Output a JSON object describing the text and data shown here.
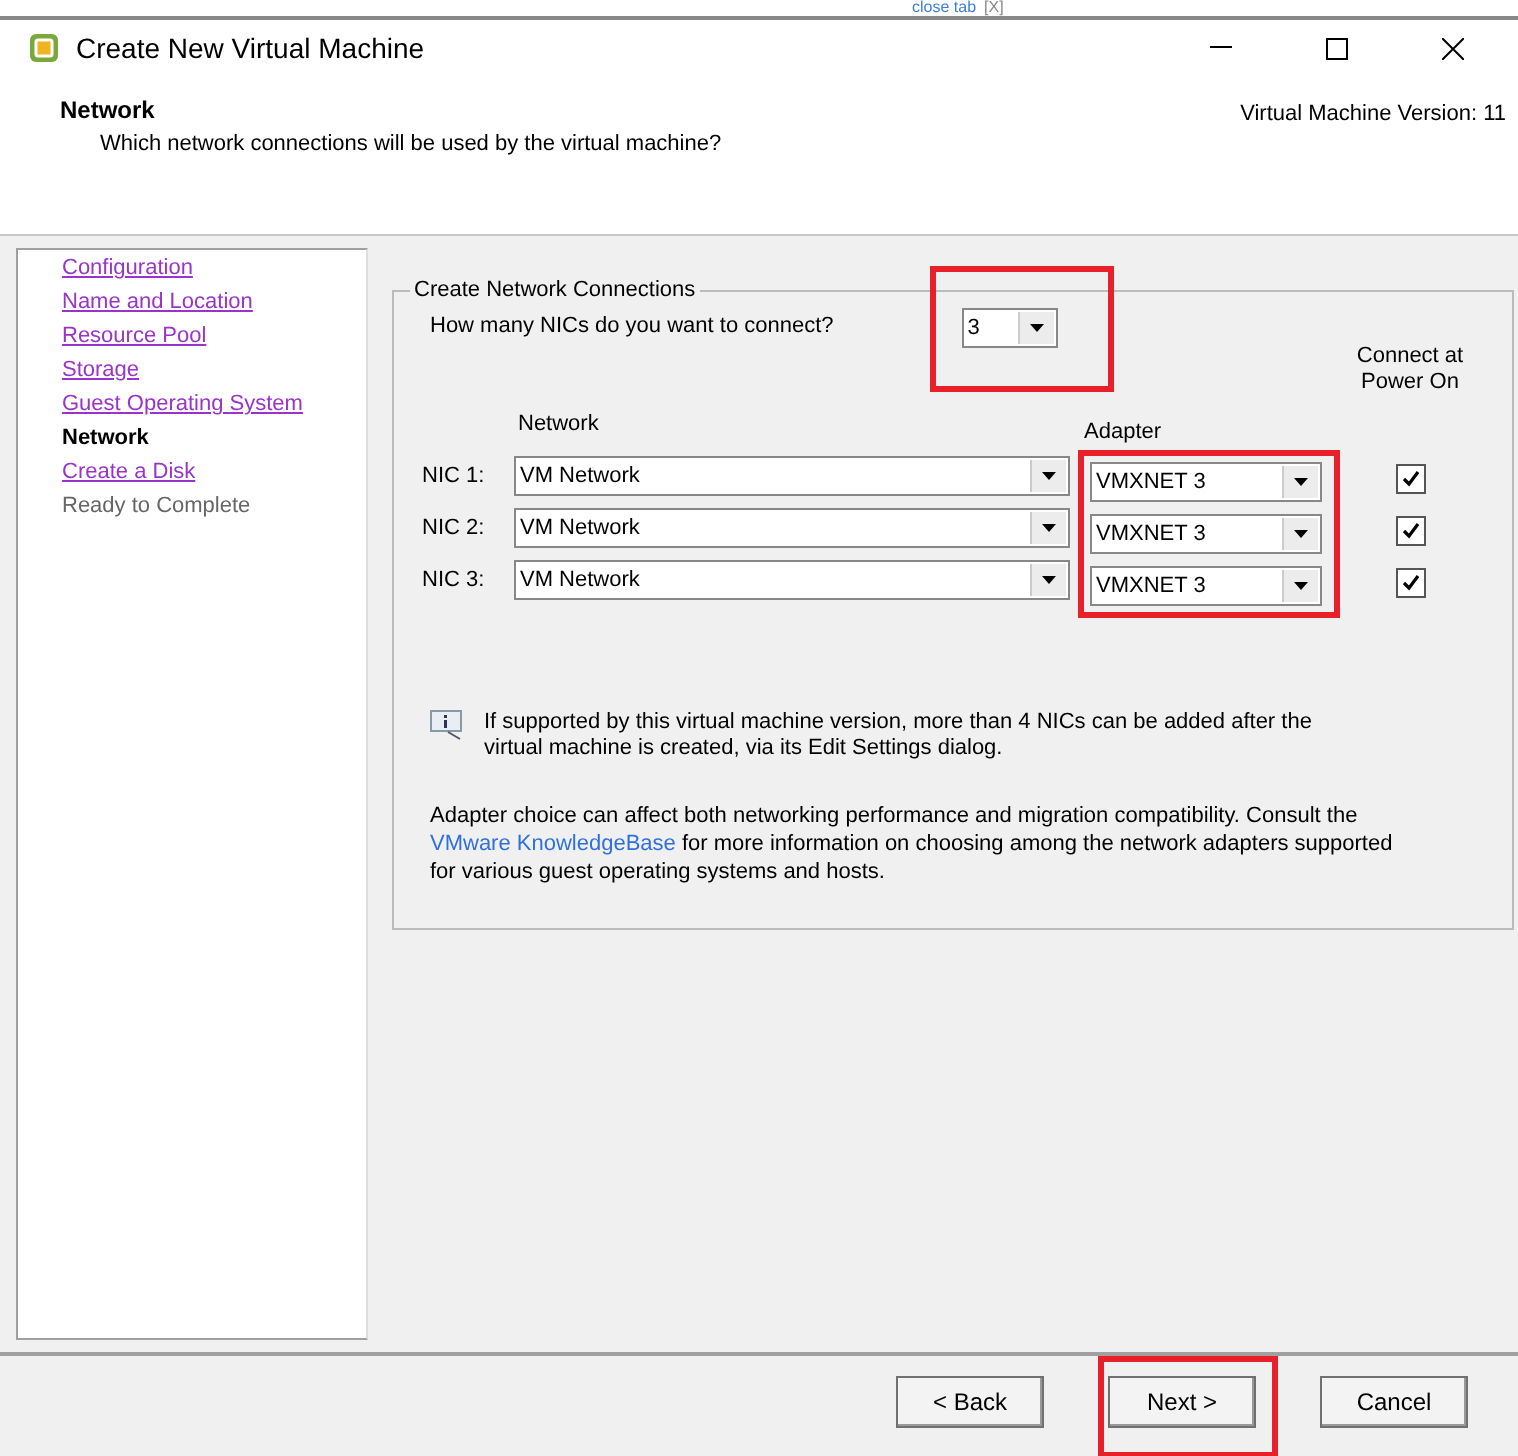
{
  "background_tab": {
    "label": "close tab",
    "close": "[X]"
  },
  "window": {
    "title": "Create New Virtual Machine"
  },
  "header": {
    "title": "Network",
    "subtitle": "Which network connections will be used by the virtual machine?",
    "version": "Virtual Machine Version: 11"
  },
  "steps": [
    {
      "label": "Configuration",
      "selected": false,
      "disabled": false
    },
    {
      "label": "Name and Location",
      "selected": false,
      "disabled": false
    },
    {
      "label": "Resource Pool",
      "selected": false,
      "disabled": false
    },
    {
      "label": "Storage",
      "selected": false,
      "disabled": false
    },
    {
      "label": "Guest Operating System",
      "selected": false,
      "disabled": false
    },
    {
      "label": "Network",
      "selected": true,
      "disabled": false
    },
    {
      "label": "Create a Disk",
      "selected": false,
      "disabled": false
    },
    {
      "label": "Ready to Complete",
      "selected": false,
      "disabled": true
    }
  ],
  "group": {
    "title": "Create Network Connections",
    "nic_count": {
      "label": "How many NICs do you want to connect?",
      "value": "3",
      "highlighted": true
    },
    "columns": {
      "network": "Network",
      "adapter": "Adapter",
      "connect": "Connect at Power On"
    },
    "adapter_highlighted": true,
    "nics": [
      {
        "label": "NIC 1:",
        "network": "VM Network",
        "adapter": "VMXNET 3",
        "checked": true
      },
      {
        "label": "NIC 2:",
        "network": "VM Network",
        "adapter": "VMXNET 3",
        "checked": true
      },
      {
        "label": "NIC 3:",
        "network": "VM Network",
        "adapter": "VMXNET 3",
        "checked": true
      }
    ],
    "info": "If supported by this virtual machine version, more than 4 NICs can be added after the virtual machine is created, via its Edit Settings dialog.",
    "note_before": "Adapter choice can affect both networking performance and migration compatibility. Consult the ",
    "note_link": "VMware KnowledgeBase",
    "note_after": " for more information on choosing among the network adapters supported for various guest operating systems and hosts."
  },
  "buttons": [
    {
      "label": "< Back",
      "highlighted": false
    },
    {
      "label": "Next >",
      "highlighted": true
    },
    {
      "label": "Cancel",
      "highlighted": false
    }
  ]
}
